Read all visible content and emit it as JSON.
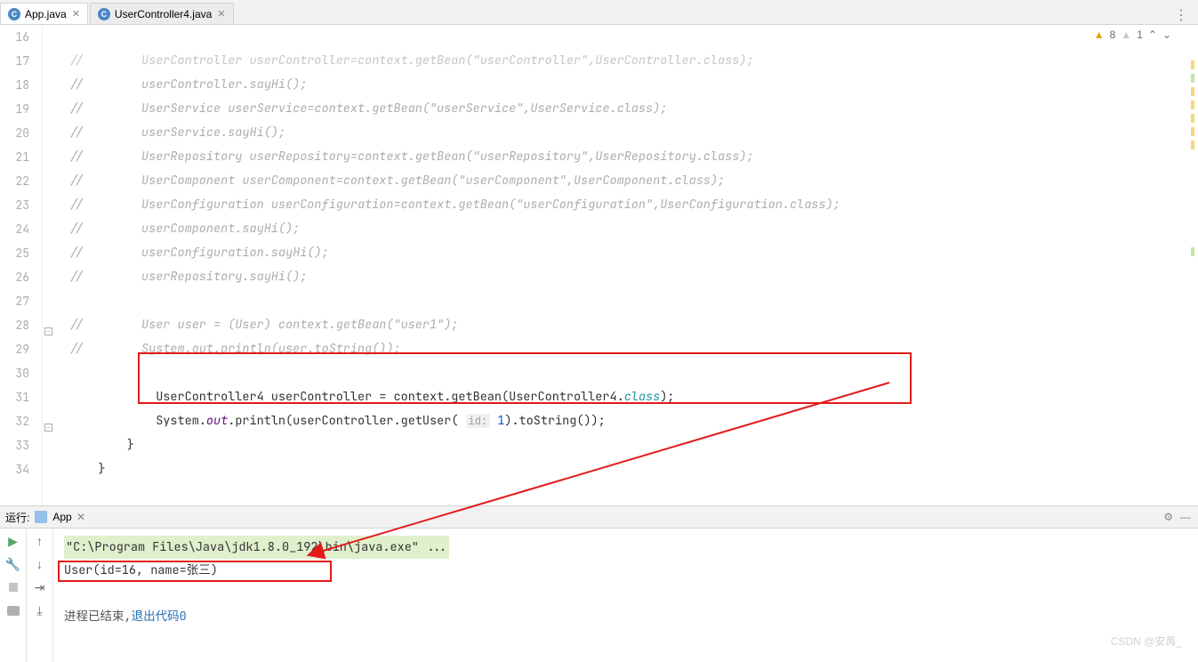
{
  "tabs": [
    {
      "icon": "C",
      "label": "App.java"
    },
    {
      "icon": "C",
      "label": "UserController4.java"
    }
  ],
  "menu_dots": "⋮",
  "inspection": {
    "warn_count": "8",
    "weak_count": "1"
  },
  "gutter_start": 16,
  "gutter_end": 34,
  "code_lines": {
    "l16": "//        UserController userController=context.getBean(\"userController\",UserController.class);",
    "l17": "//        userController.sayHi();",
    "l18": "//        UserService userService=context.getBean(\"userService\",UserService.class);",
    "l19": "//        userService.sayHi();",
    "l20": "//        UserRepository userRepository=context.getBean(\"userRepository\",UserRepository.class);",
    "l21": "//        UserComponent userComponent=context.getBean(\"userComponent\",UserComponent.class);",
    "l22": "//        UserConfiguration userConfiguration=context.getBean(\"userConfiguration\",UserConfiguration.class);",
    "l23": "//        userComponent.sayHi();",
    "l24": "//        userConfiguration.sayHi();",
    "l25": "//        userRepository.sayHi();",
    "l26": "",
    "l27": "//        User user = (User) context.getBean(\"user1\");",
    "l28": "//        System.out.println(user.toString());",
    "l29": "",
    "l30_a": "            UserController4 userController = context.getBean(UserController4.",
    "l30_b": "class",
    "l30_c": ");",
    "l31_a": "            System.",
    "l31_out": "out",
    "l31_b": ".println(userController.getUser(",
    "l31_hint": "id:",
    "l31_num": " 1",
    "l31_c": ").toString());",
    "l32": "        }",
    "l33": "    }",
    "l34": ""
  },
  "run": {
    "label": "运行:",
    "app_name": "App",
    "cmd_line": "\"C:\\Program Files\\Java\\jdk1.8.0_192\\bin\\java.exe\" ...",
    "output_line": "User(id=16, name=张三)",
    "exit_prefix": "进程已结束,",
    "exit_suffix": "退出代码0"
  },
  "watermark": "CSDN @安苒_"
}
